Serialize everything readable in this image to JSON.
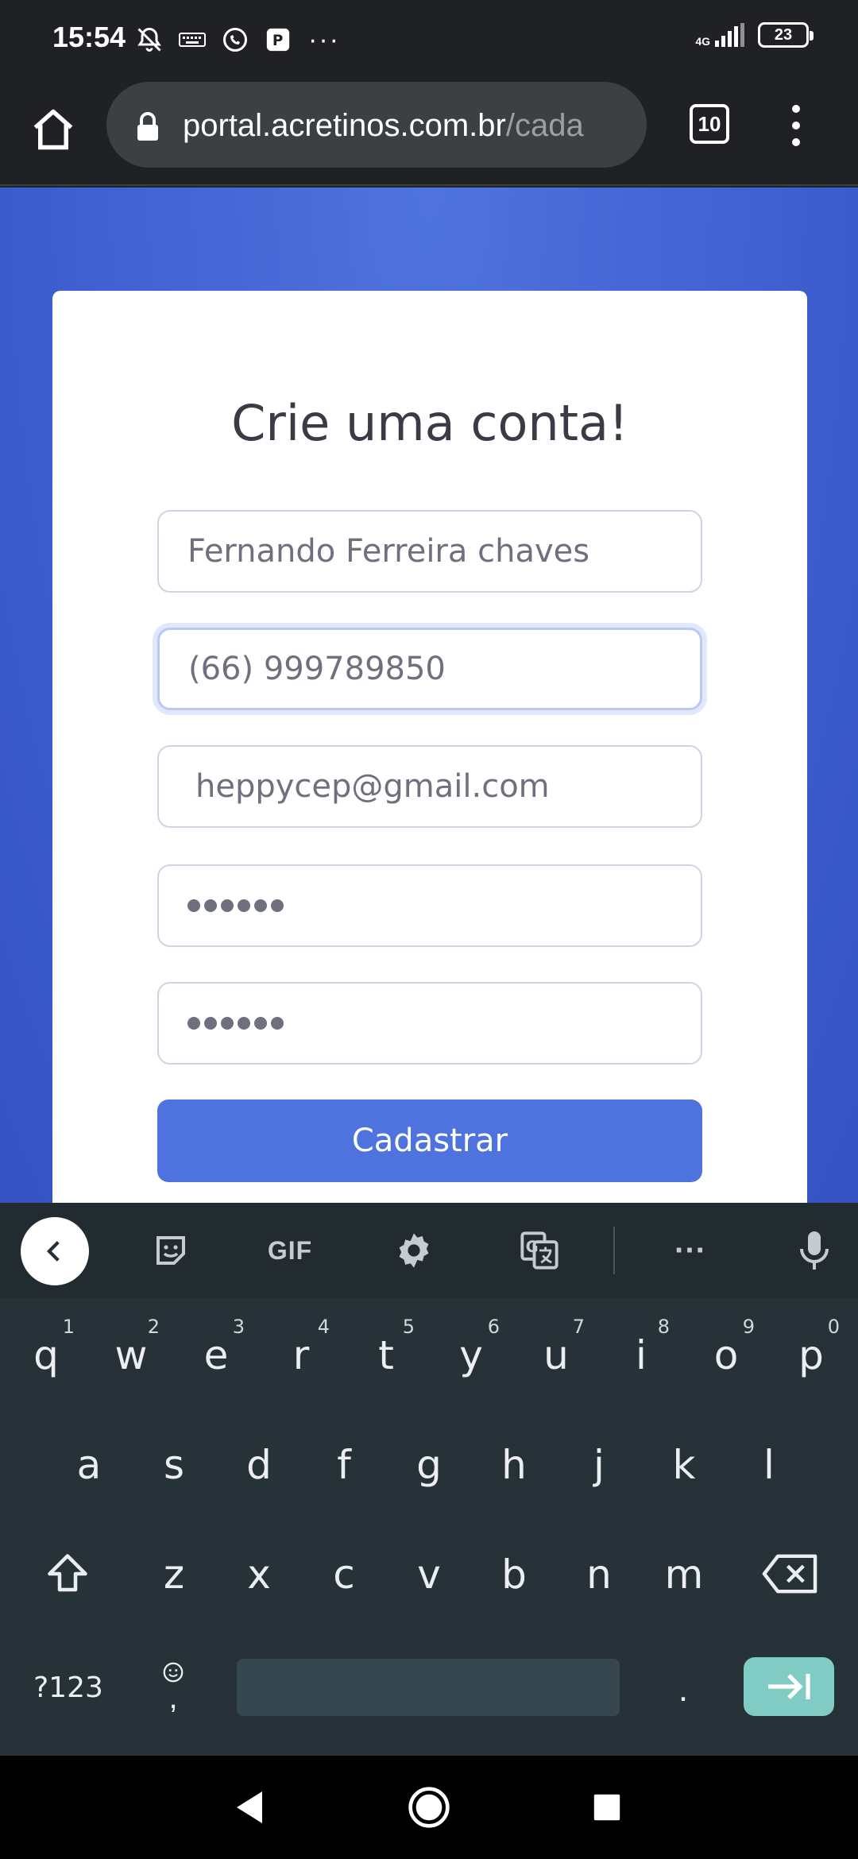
{
  "status_bar": {
    "time": "15:54",
    "network": "4G",
    "battery": "23"
  },
  "browser": {
    "url_host": "portal.acretinos.com.br",
    "url_path": "/cada",
    "tab_count": "10"
  },
  "form": {
    "title": "Crie uma conta!",
    "name_value": "Fernando Ferreira chaves",
    "phone_value": "(66) 999789850",
    "email_value": "heppycep@gmail.com",
    "password_dots": 6,
    "confirm_password_dots": 6,
    "submit_label": "Cadastrar"
  },
  "keyboard": {
    "toolbar_gif": "GIF",
    "row1": [
      {
        "key": "q",
        "hint": "1"
      },
      {
        "key": "w",
        "hint": "2"
      },
      {
        "key": "e",
        "hint": "3"
      },
      {
        "key": "r",
        "hint": "4"
      },
      {
        "key": "t",
        "hint": "5"
      },
      {
        "key": "y",
        "hint": "6"
      },
      {
        "key": "u",
        "hint": "7"
      },
      {
        "key": "i",
        "hint": "8"
      },
      {
        "key": "o",
        "hint": "9"
      },
      {
        "key": "p",
        "hint": "0"
      }
    ],
    "row2": [
      "a",
      "s",
      "d",
      "f",
      "g",
      "h",
      "j",
      "k",
      "l"
    ],
    "row3": [
      "z",
      "x",
      "c",
      "v",
      "b",
      "n",
      "m"
    ],
    "symbols_label": "?123",
    "comma_label": ",",
    "period_label": "."
  },
  "colors": {
    "page_bg": "#4e73df",
    "button": "#4e73df",
    "keyboard_bg": "#263238",
    "enter_key": "#80cbc4"
  }
}
